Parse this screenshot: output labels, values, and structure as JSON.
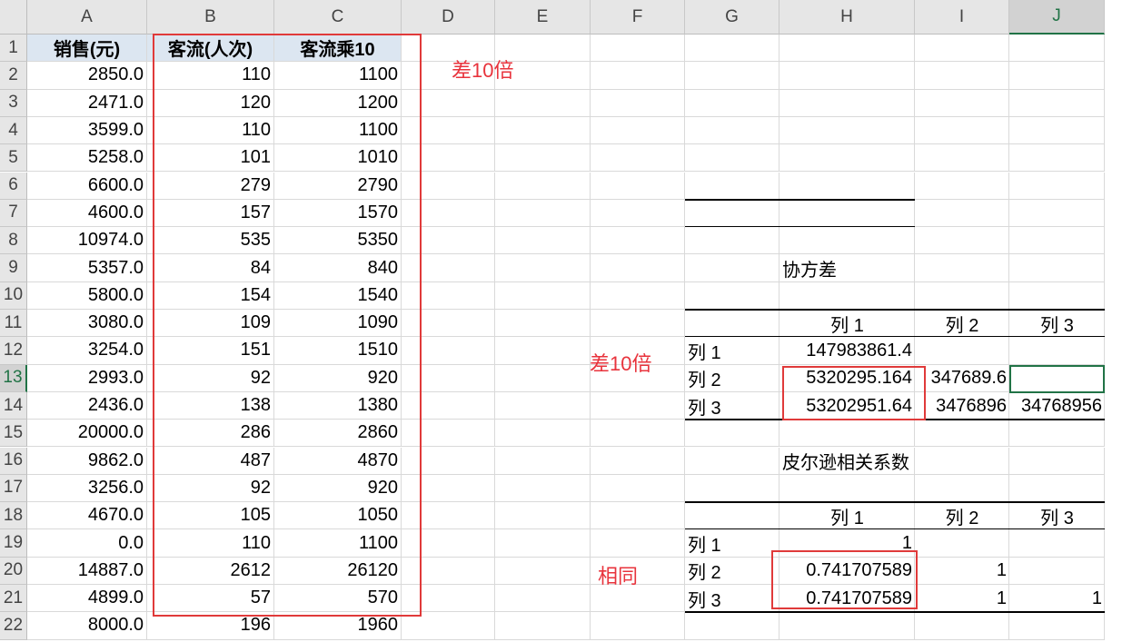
{
  "columns": [
    "A",
    "B",
    "C",
    "D",
    "E",
    "F",
    "G",
    "H",
    "I",
    "J"
  ],
  "rows": [
    "1",
    "2",
    "3",
    "4",
    "5",
    "6",
    "7",
    "8",
    "9",
    "10",
    "11",
    "12",
    "13",
    "14",
    "15",
    "16",
    "17",
    "18",
    "19",
    "20",
    "21",
    "22"
  ],
  "headers": {
    "A": "销售(元)",
    "B": "客流(人次)",
    "C": "客流乘10"
  },
  "data": [
    [
      "2850.0",
      "110",
      "1100"
    ],
    [
      "2471.0",
      "120",
      "1200"
    ],
    [
      "3599.0",
      "110",
      "1100"
    ],
    [
      "5258.0",
      "101",
      "1010"
    ],
    [
      "6600.0",
      "279",
      "2790"
    ],
    [
      "4600.0",
      "157",
      "1570"
    ],
    [
      "10974.0",
      "535",
      "5350"
    ],
    [
      "5357.0",
      "84",
      "840"
    ],
    [
      "5800.0",
      "154",
      "1540"
    ],
    [
      "3080.0",
      "109",
      "1090"
    ],
    [
      "3254.0",
      "151",
      "1510"
    ],
    [
      "2993.0",
      "92",
      "920"
    ],
    [
      "2436.0",
      "138",
      "1380"
    ],
    [
      "20000.0",
      "286",
      "2860"
    ],
    [
      "9862.0",
      "487",
      "4870"
    ],
    [
      "3256.0",
      "92",
      "920"
    ],
    [
      "4670.0",
      "105",
      "1050"
    ],
    [
      "0.0",
      "110",
      "1100"
    ],
    [
      "14887.0",
      "2612",
      "26120"
    ],
    [
      "4899.0",
      "57",
      "570"
    ],
    [
      "8000.0",
      "196",
      "1960"
    ]
  ],
  "annotations": {
    "top": "差10倍",
    "middle": "差10倍",
    "bottom": "相同"
  },
  "covariance": {
    "title": "协方差",
    "col_headers": [
      "列 1",
      "列 2",
      "列 3"
    ],
    "row_labels": [
      "列 1",
      "列 2",
      "列 3"
    ],
    "values": [
      [
        "147983861.4",
        "",
        ""
      ],
      [
        "5320295.164",
        "347689.6",
        ""
      ],
      [
        "53202951.64",
        "3476896",
        "34768956"
      ]
    ]
  },
  "pearson": {
    "title": "皮尔逊相关系数",
    "col_headers": [
      "列 1",
      "列 2",
      "列 3"
    ],
    "row_labels": [
      "列 1",
      "列 2",
      "列 3"
    ],
    "values": [
      [
        "1",
        "",
        ""
      ],
      [
        "0.741707589",
        "1",
        ""
      ],
      [
        "0.741707589",
        "1",
        "1"
      ]
    ]
  },
  "colors": {
    "annotation": "#e8333c",
    "header_fill": "#dce6f1",
    "selection": "#217346"
  }
}
